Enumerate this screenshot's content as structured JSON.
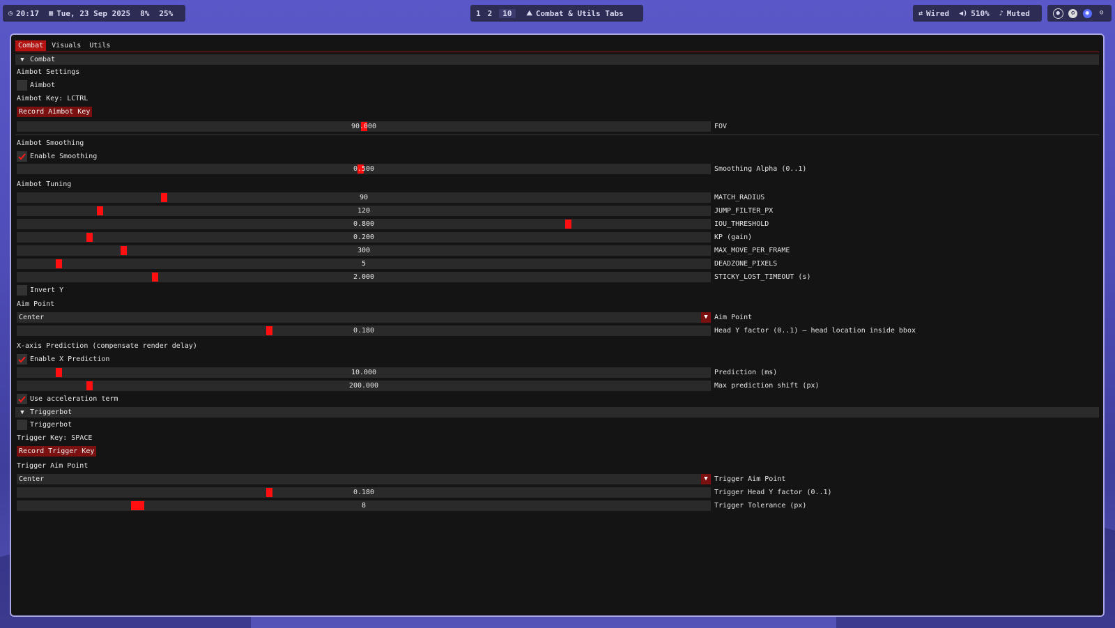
{
  "statusbar": {
    "time": "20:17",
    "date": "Tue, 23 Sep 2025",
    "cpu": "8%",
    "mem": "25%",
    "workspaces": [
      "1",
      "2",
      "10"
    ],
    "window_title": "Combat & Utils Tabs",
    "network": "Wired",
    "volume": "510%",
    "mic": "Muted"
  },
  "tabs": [
    "Combat",
    "Visuals",
    "Utils"
  ],
  "active_tab": "Combat",
  "combat": {
    "header": "Combat",
    "aimbot_settings": "Aimbot Settings",
    "aimbot_checkbox": "Aimbot",
    "aimbot_key": "Aimbot Key: LCTRL",
    "record_aimbot_key": "Record Aimbot Key",
    "fov": {
      "value": "90.000",
      "label": "FOV",
      "fraction": 0.5
    },
    "aimbot_smoothing": "Aimbot Smoothing",
    "enable_smoothing": "Enable Smoothing",
    "smoothing_alpha": {
      "value": "0.500",
      "label": "Smoothing Alpha (0..1)",
      "fraction": 0.495
    },
    "aimbot_tuning": "Aimbot Tuning",
    "tuning": [
      {
        "value": "90",
        "label": "MATCH_RADIUS",
        "fraction": 0.21
      },
      {
        "value": "120",
        "label": "JUMP_FILTER_PX",
        "fraction": 0.117
      },
      {
        "value": "0.800",
        "label": "IOU_THRESHOLD",
        "fraction": 0.797
      },
      {
        "value": "0.200",
        "label": "KP (gain)",
        "fraction": 0.101
      },
      {
        "value": "300",
        "label": "MAX_MOVE_PER_FRAME",
        "fraction": 0.151
      },
      {
        "value": "5",
        "label": "DEADZONE_PIXELS",
        "fraction": 0.057
      },
      {
        "value": "2.000",
        "label": "STICKY_LOST_TIMEOUT (s)",
        "fraction": 0.197
      }
    ],
    "invert_y": "Invert Y",
    "aim_point_title": "Aim Point",
    "aim_point": {
      "value": "Center",
      "label": "Aim Point"
    },
    "head_y": {
      "value": "0.180",
      "label": "Head Y factor (0..1) — head location inside bbox",
      "fraction": 0.363
    },
    "x_prediction_title": "X-axis Prediction (compensate render delay)",
    "enable_x_prediction": "Enable X Prediction",
    "prediction_ms": {
      "value": "10.000",
      "label": "Prediction (ms)",
      "fraction": 0.057
    },
    "max_shift": {
      "value": "200.000",
      "label": "Max prediction shift (px)",
      "fraction": 0.101
    },
    "use_accel": "Use acceleration term"
  },
  "triggerbot": {
    "header": "Triggerbot",
    "checkbox": "Triggerbot",
    "trigger_key": "Trigger Key: SPACE",
    "record_trigger_key": "Record Trigger Key",
    "aim_point_title": "Trigger Aim Point",
    "aim_point": {
      "value": "Center",
      "label": "Trigger Aim Point"
    },
    "head_y": {
      "value": "0.180",
      "label": "Trigger Head Y factor (0..1)",
      "fraction": 0.363
    },
    "tolerance": {
      "value": "8",
      "label": "Trigger Tolerance (px)",
      "fraction": 0.168
    }
  },
  "colors": {
    "accent": "#ff0f0f",
    "button": "#7a1010",
    "tab_active": "#b51212",
    "window_bg": "#141414",
    "frame": "#a8a6e6"
  }
}
